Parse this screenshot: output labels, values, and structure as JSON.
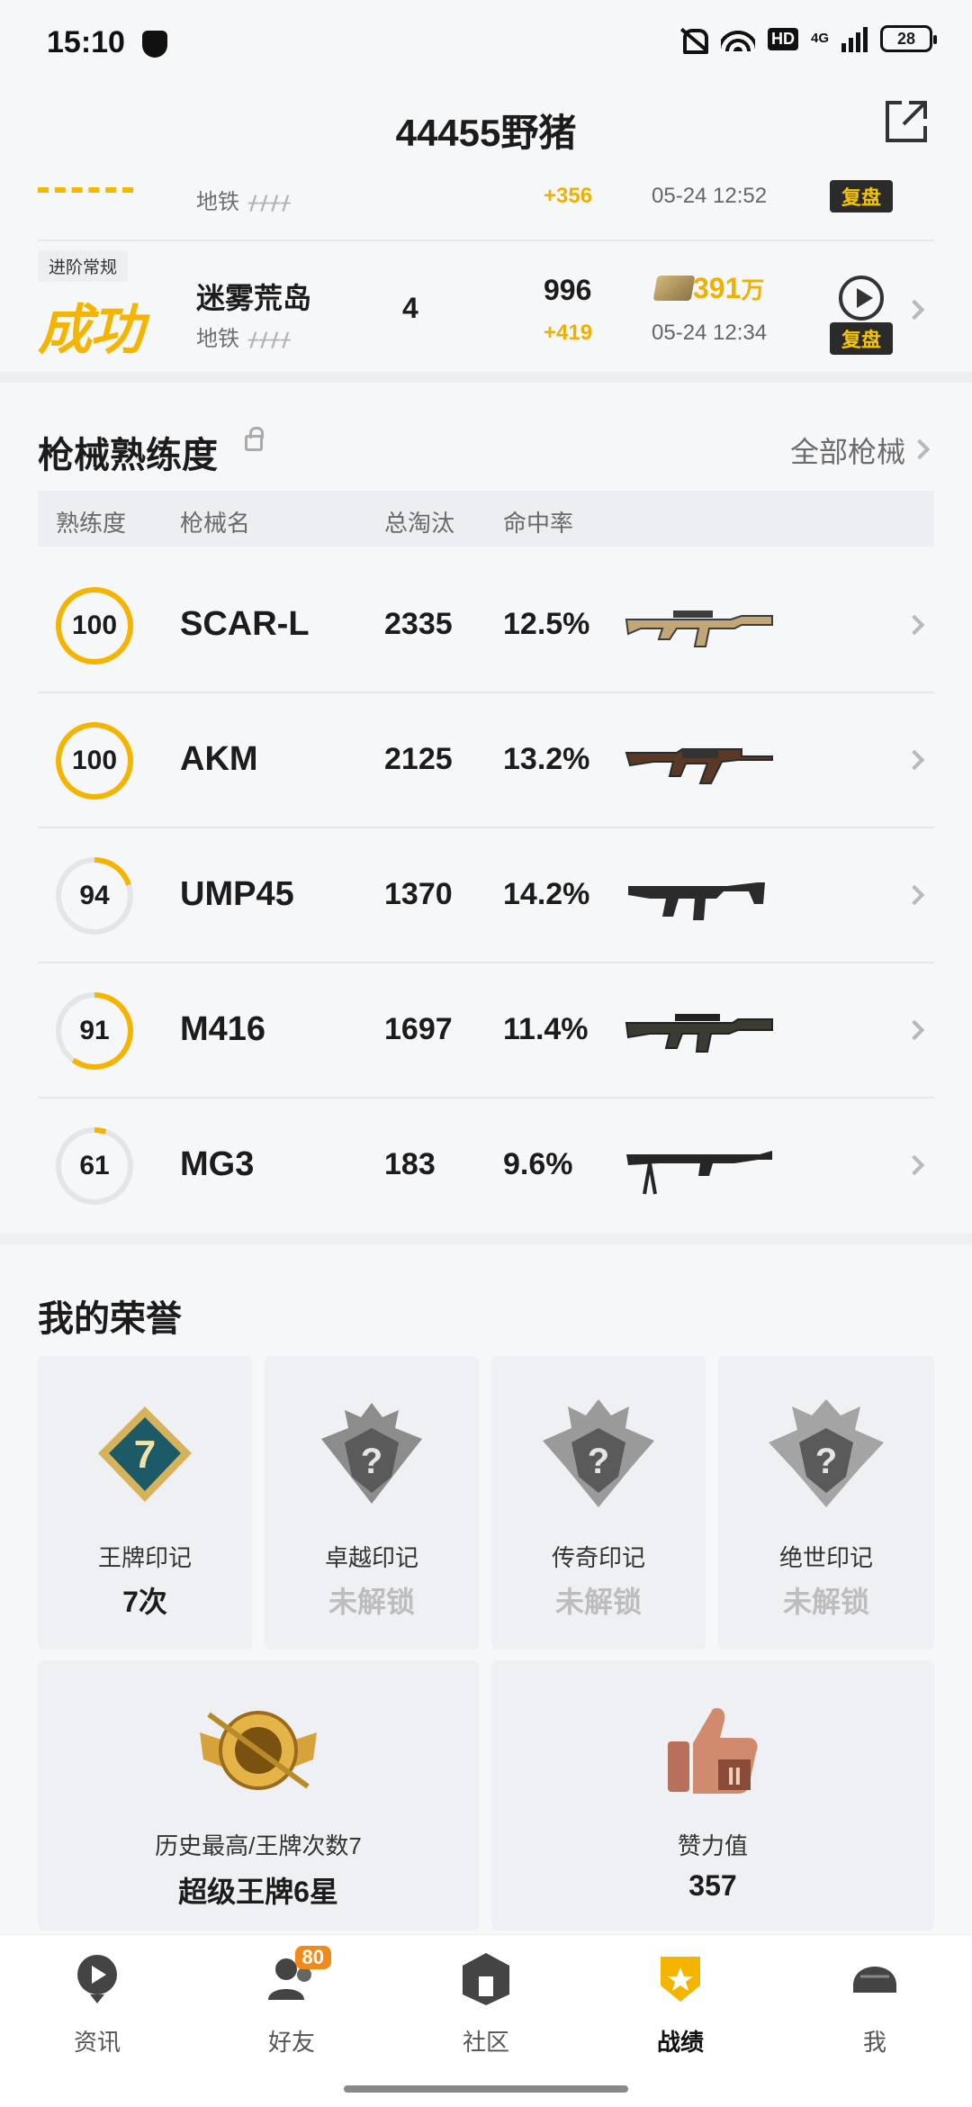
{
  "status_bar": {
    "time": "15:10",
    "network": "4G",
    "hd": "HD",
    "battery": "28"
  },
  "header": {
    "title": "44455野猪"
  },
  "matches": [
    {
      "map_sub": "地铁",
      "score_delta": "+356",
      "time": "05-24 12:52",
      "replay": "复盘"
    },
    {
      "mode": "进阶常规",
      "result": "成功",
      "map": "迷雾荒岛",
      "map_sub": "地铁",
      "rank": "4",
      "score": "996",
      "score_delta": "+419",
      "money": "391",
      "money_unit": "万",
      "time": "05-24 12:34",
      "replay": "复盘"
    }
  ],
  "weapons": {
    "title": "枪械熟练度",
    "all_link": "全部枪械",
    "headers": [
      "熟练度",
      "枪械名",
      "总淘汰",
      "命中率"
    ],
    "rows": [
      {
        "mastery": "100",
        "progress": 1.0,
        "name": "SCAR-L",
        "kills": "2335",
        "rate": "12.5%",
        "gun": "scar-l-icon"
      },
      {
        "mastery": "100",
        "progress": 1.0,
        "name": "AKM",
        "kills": "2125",
        "rate": "13.2%",
        "gun": "akm-icon"
      },
      {
        "mastery": "94",
        "progress": 0.2,
        "name": "UMP45",
        "kills": "1370",
        "rate": "14.2%",
        "gun": "ump45-icon"
      },
      {
        "mastery": "91",
        "progress": 0.6,
        "name": "M416",
        "kills": "1697",
        "rate": "11.4%",
        "gun": "m416-icon"
      },
      {
        "mastery": "61",
        "progress": 0.05,
        "name": "MG3",
        "kills": "183",
        "rate": "9.6%",
        "gun": "mg3-icon"
      }
    ]
  },
  "honors": {
    "title": "我的荣誉",
    "marks": [
      {
        "name": "王牌印记",
        "value": "7次",
        "badge_number": "7",
        "locked": false
      },
      {
        "name": "卓越印记",
        "value": "未解锁",
        "locked": true
      },
      {
        "name": "传奇印记",
        "value": "未解锁",
        "locked": true
      },
      {
        "name": "绝世印记",
        "value": "未解锁",
        "locked": true
      }
    ],
    "stats": [
      {
        "name": "历史最高/王牌次数7",
        "value": "超级王牌6星"
      },
      {
        "name": "赞力值",
        "value": "357"
      }
    ]
  },
  "nav": {
    "items": [
      {
        "label": "资讯"
      },
      {
        "label": "好友",
        "badge": "80"
      },
      {
        "label": "社区"
      },
      {
        "label": "战绩",
        "active": true
      },
      {
        "label": "我"
      }
    ]
  },
  "colors": {
    "accent": "#f5b400",
    "background": "#f6f7f9",
    "text": "#1c1c1c"
  }
}
